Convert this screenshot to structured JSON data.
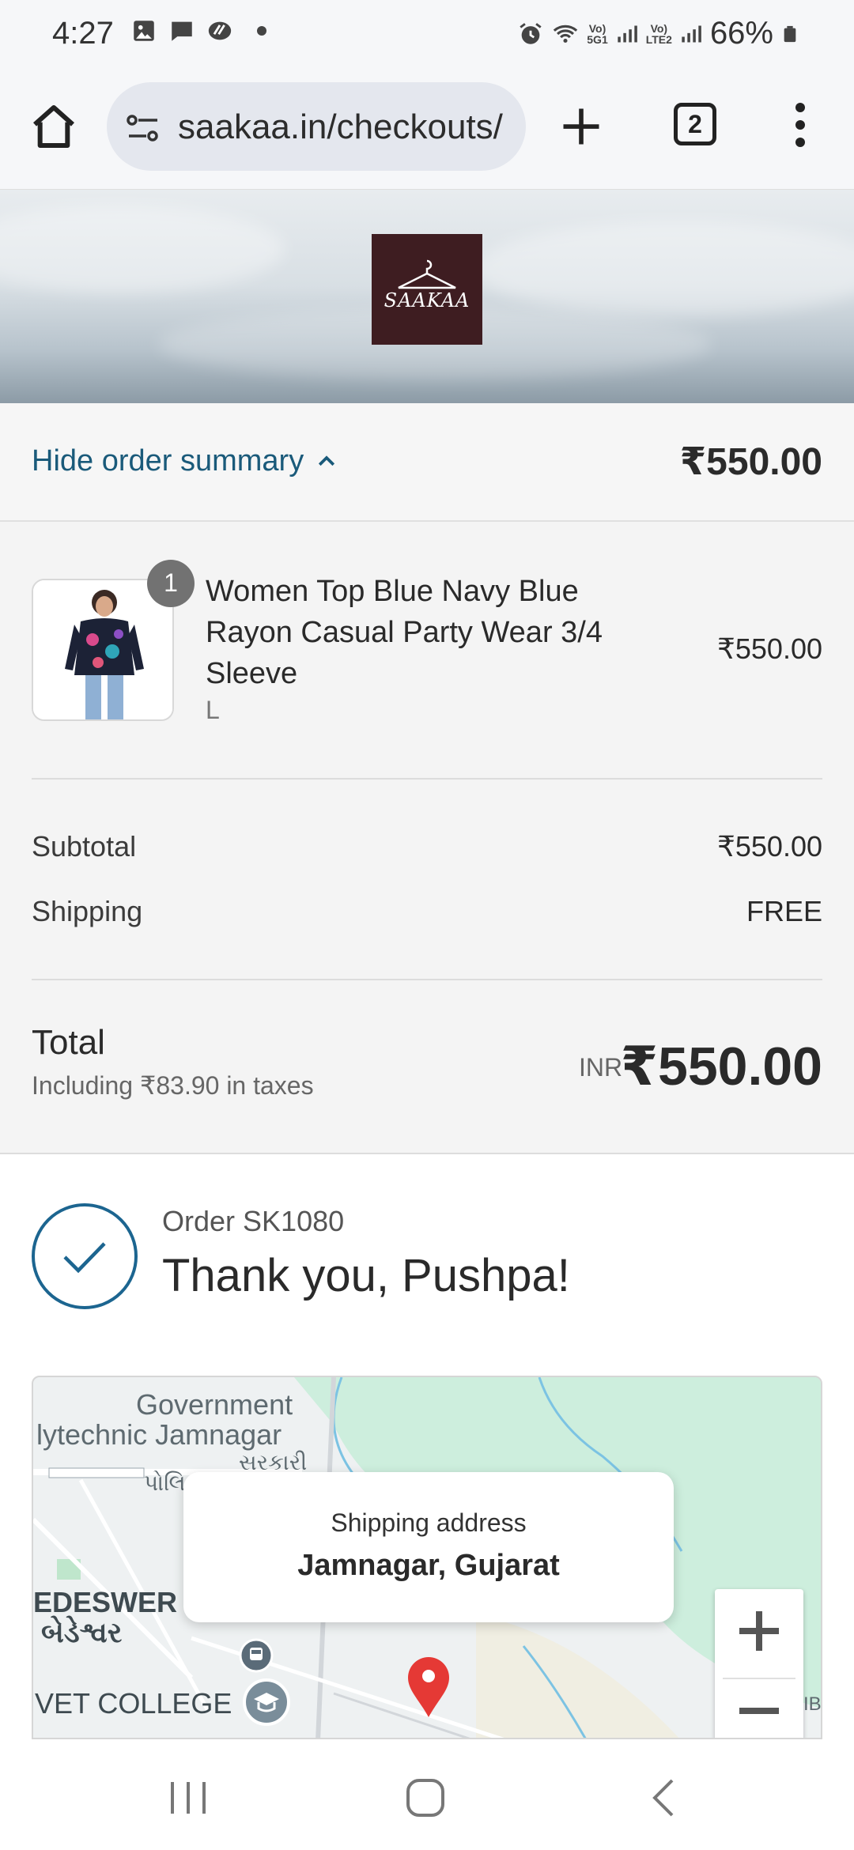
{
  "status_bar": {
    "time": "4:27",
    "battery": "66%",
    "net1_top": "Vo)",
    "net1_bottom": "5G1",
    "net2_top": "Vo)",
    "net2_bottom": "LTE2"
  },
  "browser": {
    "url": "saakaa.in/checkouts/",
    "tab_count": "2"
  },
  "store": {
    "logo_text": "SAAKAA",
    "brand_color": "#3e1d21"
  },
  "summary": {
    "toggle_label": "Hide order summary",
    "toggle_total": "₹550.00",
    "item": {
      "title": "Women Top Blue Navy Blue Rayon Casual Party Wear 3/4 Sleeve",
      "variant": "L",
      "quantity": "1",
      "price": "₹550.00"
    },
    "subtotal_label": "Subtotal",
    "subtotal_value": "₹550.00",
    "shipping_label": "Shipping",
    "shipping_value": "FREE",
    "total_label": "Total",
    "tax_note": "Including ₹83.90 in taxes",
    "currency": "INR",
    "total_value": "₹550.00"
  },
  "confirmation": {
    "order_number": "Order SK1080",
    "thank_you": "Thank you, Pushpa!"
  },
  "map": {
    "label_govt": "Government",
    "label_poly": "lytechnic Jamnagar",
    "label_sarkari": "સરકારી",
    "label_poli": "પોલિ",
    "label_bedeswar": "EDESWER",
    "label_bedeswar_gu": "બેડેશ્વર",
    "label_vet": "VET COLLEGE",
    "label_edge": "IB",
    "popup_title": "Shipping address",
    "popup_city": "Jamnagar, Gujarat",
    "accent_color": "#1c6590"
  }
}
